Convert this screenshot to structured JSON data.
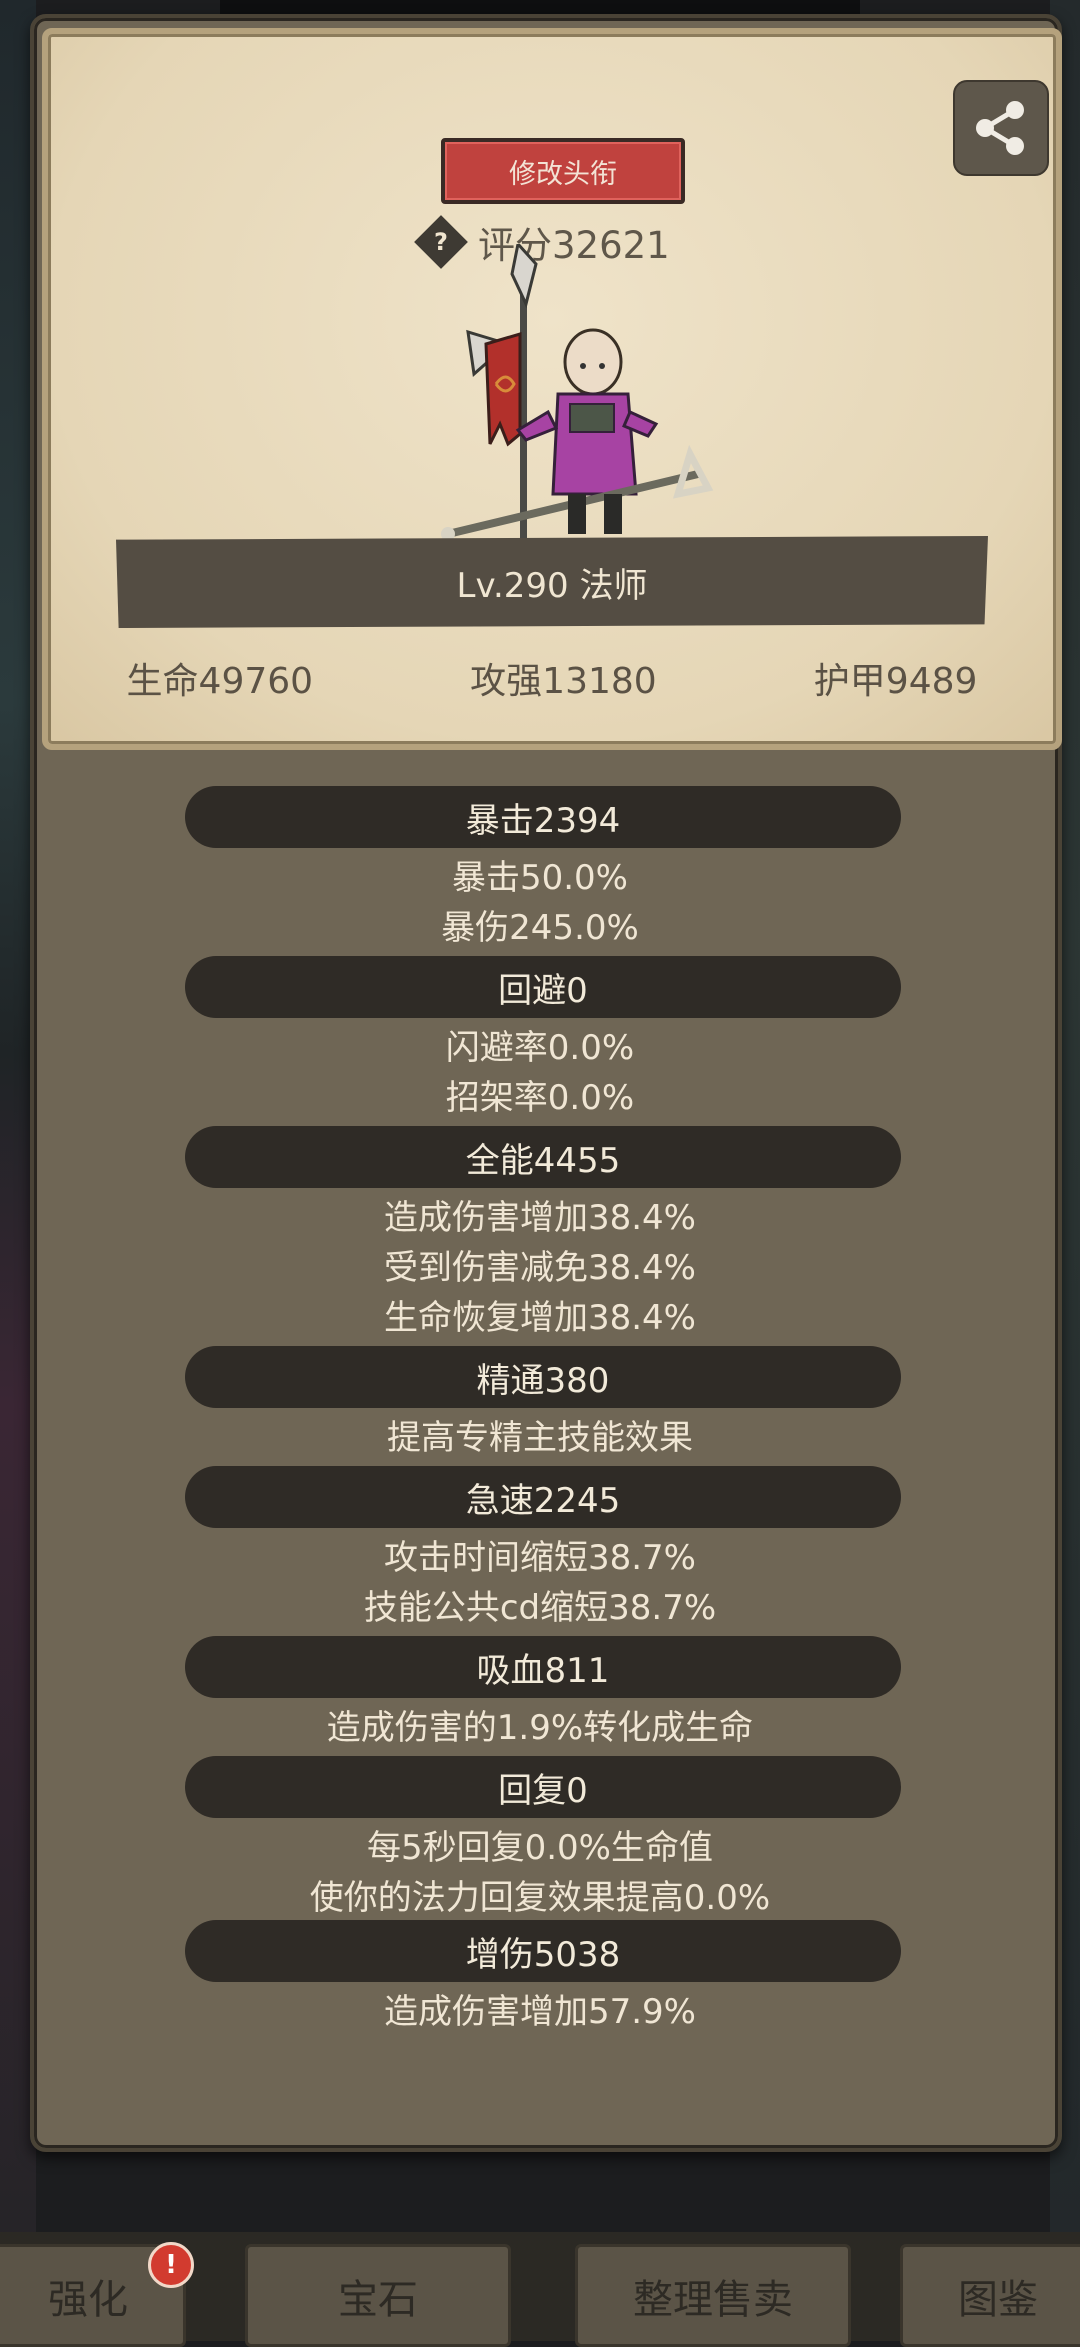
{
  "header": {
    "edit_title_label": "修改头衔",
    "score_help_glyph": "?",
    "score_text": "评分32621",
    "level_text": "Lv.290 法师"
  },
  "base_stats": {
    "hp": "生命49760",
    "attack": "攻强13180",
    "armor": "护甲9489"
  },
  "sections": [
    {
      "title": "暴击2394",
      "lines": [
        "暴击50.0%",
        "暴伤245.0%"
      ]
    },
    {
      "title": "回避0",
      "lines": [
        "闪避率0.0%",
        "招架率0.0%"
      ]
    },
    {
      "title": "全能4455",
      "lines": [
        "造成伤害增加38.4%",
        "受到伤害减免38.4%",
        "生命恢复增加38.4%"
      ]
    },
    {
      "title": "精通380",
      "lines": [
        "提高专精主技能效果"
      ]
    },
    {
      "title": "急速2245",
      "lines": [
        "攻击时间缩短38.7%",
        "技能公共cd缩短38.7%"
      ]
    },
    {
      "title": "吸血811",
      "lines": [
        "造成伤害的1.9%转化成生命"
      ]
    },
    {
      "title": "回复0",
      "lines": [
        "每5秒回复0.0%生命值",
        "使你的法力回复效果提高0.0%"
      ]
    },
    {
      "title": "增伤5038",
      "lines": [
        "造成伤害增加57.9%"
      ]
    }
  ],
  "bottom_menu": {
    "enhance": "强化",
    "gems": "宝石",
    "sort_sell": "整理售卖",
    "codex": "图鉴",
    "enhance_badge": "!"
  },
  "colors": {
    "panel": "#6f6655",
    "card": "#e8dbbf",
    "title_button": "#c0423e",
    "section_bar": "#2f2b26",
    "text_light": "#f0e6d4",
    "text_dark": "#5b5245"
  },
  "icons": {
    "share": "share-icon",
    "help": "question-icon"
  }
}
